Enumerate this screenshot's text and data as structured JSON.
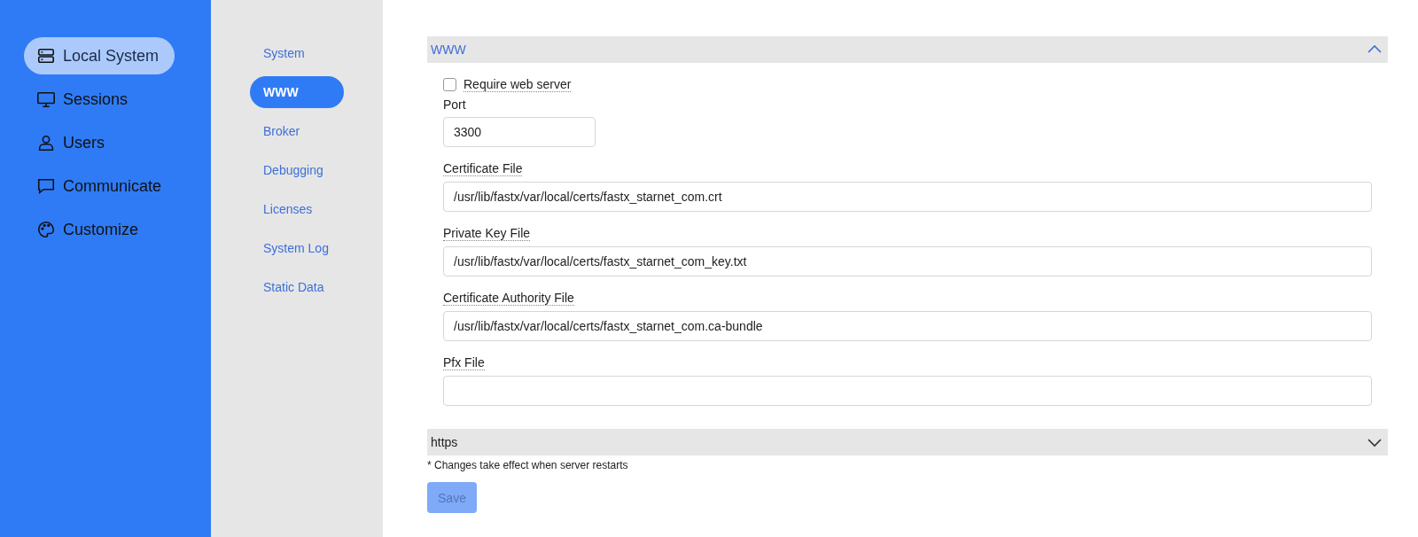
{
  "sidebar": {
    "items": [
      {
        "label": "Local System",
        "selected": true
      },
      {
        "label": "Sessions",
        "selected": false
      },
      {
        "label": "Users",
        "selected": false
      },
      {
        "label": "Communicate",
        "selected": false
      },
      {
        "label": "Customize",
        "selected": false
      }
    ]
  },
  "subnav": {
    "items": [
      {
        "label": "System",
        "selected": false
      },
      {
        "label": "WWW",
        "selected": true
      },
      {
        "label": "Broker",
        "selected": false
      },
      {
        "label": "Debugging",
        "selected": false
      },
      {
        "label": "Licenses",
        "selected": false
      },
      {
        "label": "System Log",
        "selected": false
      },
      {
        "label": "Static Data",
        "selected": false
      }
    ]
  },
  "sections": [
    {
      "title": "WWW",
      "expanded": true,
      "fields": [
        {
          "kind": "checkbox",
          "label": "Require web server",
          "checked": false
        },
        {
          "kind": "short",
          "label": "Port",
          "value": "3300"
        },
        {
          "kind": "long",
          "label": "Certificate File",
          "value": "/usr/lib/fastx/var/local/certs/fastx_starnet_com.crt"
        },
        {
          "kind": "long",
          "label": "Private Key File",
          "value": "/usr/lib/fastx/var/local/certs/fastx_starnet_com_key.txt"
        },
        {
          "kind": "long",
          "label": "Certificate Authority File",
          "value": "/usr/lib/fastx/var/local/certs/fastx_starnet_com.ca-bundle"
        },
        {
          "kind": "long",
          "label": "Pfx File"
        }
      ]
    },
    {
      "title": "https",
      "expanded": false
    }
  ],
  "note": "* Changes take effect when server restarts",
  "save_button": {
    "label": "Save",
    "disabled": true
  }
}
